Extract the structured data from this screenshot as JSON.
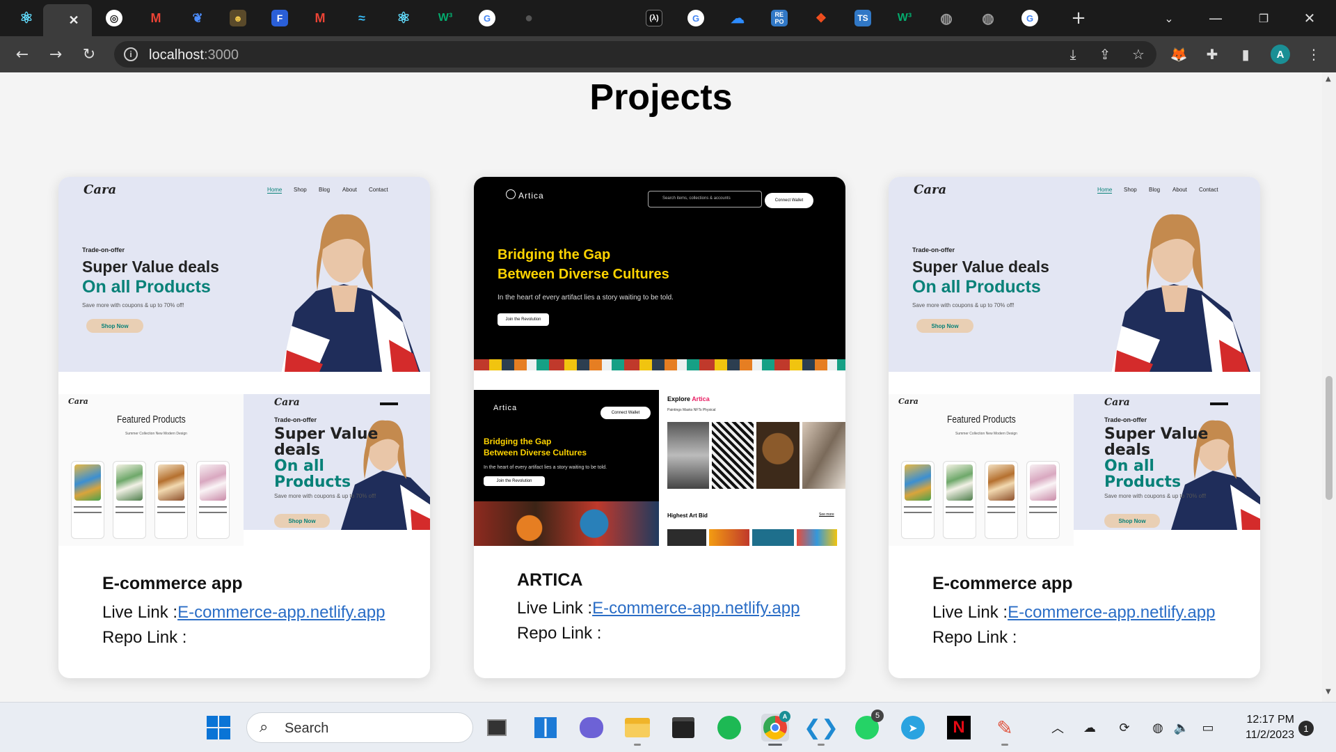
{
  "browser": {
    "address": {
      "host": "localhost",
      "port": ":3000"
    }
  },
  "page": {
    "heading": "Projects",
    "cards": [
      {
        "title": "E-commerce app",
        "live_label": "Live Link :",
        "live_url": "E-commerce-app.netlify.app",
        "repo_label": "Repo Link :",
        "shot": {
          "logo": "Cara",
          "nav": [
            "Home",
            "Shop",
            "Blog",
            "About",
            "Contact"
          ],
          "eyebrow": "Trade-on-offer",
          "headline": "Super Value deals",
          "highlight": "On all Products",
          "sub": "Save more with coupons & up to 70% off!",
          "cta": "Shop Now",
          "featured": "Featured Products",
          "featured_sub": "Summer Collection New Modern Design",
          "big1": "Super Value",
          "big2": "deals",
          "big3": "On all",
          "big4": "Products",
          "big_sub": "Save more with coupons & up to 70% off!",
          "big_cta": "Shop Now"
        }
      },
      {
        "title": "ARTICA",
        "live_label": "Live Link :",
        "live_url": "E-commerce-app.netlify.app",
        "repo_label": "Repo Link :",
        "shot": {
          "logo": "Artica",
          "search": "Search items, collections & accounts",
          "connect": "Connect Wallet",
          "headline1": "Bridging the Gap",
          "headline2": "Between Diverse Cultures",
          "para": "In the heart of every artifact lies a story waiting to be told.",
          "cta": "Join the Revolution",
          "explore": "Explore",
          "explore_hl": "Artica",
          "filters": "Paintings  Masks  NFTs  Physical",
          "highest": "Highest Art Bid",
          "see_more": "See more"
        }
      },
      {
        "title": "E-commerce app",
        "live_label": "Live Link :",
        "live_url": "E-commerce-app.netlify.app",
        "repo_label": "Repo Link :",
        "shot": {
          "logo": "Cara",
          "nav": [
            "Home",
            "Shop",
            "Blog",
            "About",
            "Contact"
          ],
          "eyebrow": "Trade-on-offer",
          "headline": "Super Value deals",
          "highlight": "On all Products",
          "sub": "Save more with coupons & up to 70% off!",
          "cta": "Shop Now",
          "featured": "Featured Products",
          "featured_sub": "Summer Collection New Modern Design",
          "big1": "Super Value",
          "big2": "deals",
          "big3": "On all",
          "big4": "Products",
          "big_sub": "Save more with coupons & up to 70% off!",
          "big_cta": "Shop Now"
        }
      }
    ]
  },
  "taskbar": {
    "search_label": "Search",
    "whatsapp_badge": "5",
    "time": "12:17 PM",
    "date": "11/2/2023",
    "notifications": "1"
  },
  "colors": {
    "link": "#2a6dc6",
    "cara_green": "#088178",
    "cara_bg": "#e3e6f3",
    "page_bg": "#f4f4f4"
  }
}
